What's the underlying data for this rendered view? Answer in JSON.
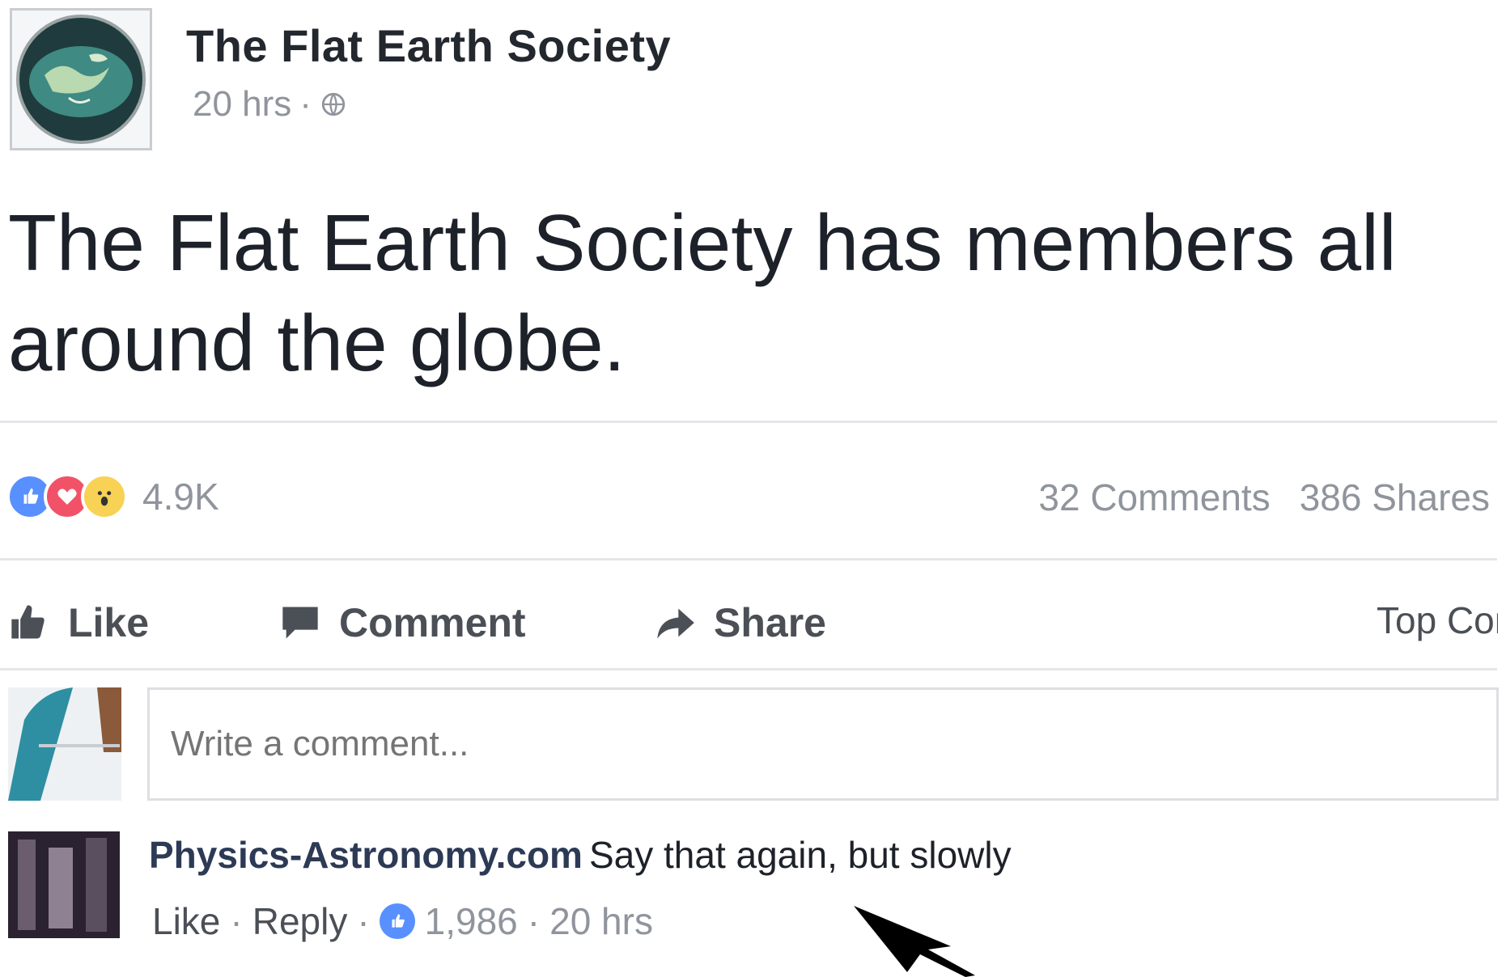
{
  "post": {
    "page_name": "The Flat Earth Society",
    "time": "20 hrs",
    "separator": "·",
    "text": "The Flat Earth Society has members all around the globe."
  },
  "reactions": {
    "count": "4.9K",
    "icons": [
      "like-reaction-icon",
      "love-reaction-icon",
      "wow-reaction-icon"
    ],
    "comments": "32 Comments",
    "shares": "386 Shares"
  },
  "actions": {
    "like": "Like",
    "comment": "Comment",
    "share": "Share",
    "top_comments": "Top Comments"
  },
  "composer": {
    "placeholder": "Write a comment..."
  },
  "comment": {
    "author": "Physics-Astronomy.com",
    "text": "Say that again, but slowly",
    "like": "Like",
    "reply": "Reply",
    "reaction_count": "1,986",
    "time": "20 hrs",
    "separator": "·"
  },
  "colors": {
    "like_blue": "#5890ff",
    "love_red": "#f25268",
    "wow_yellow": "#f7d254",
    "meta_gray": "#90949c"
  }
}
